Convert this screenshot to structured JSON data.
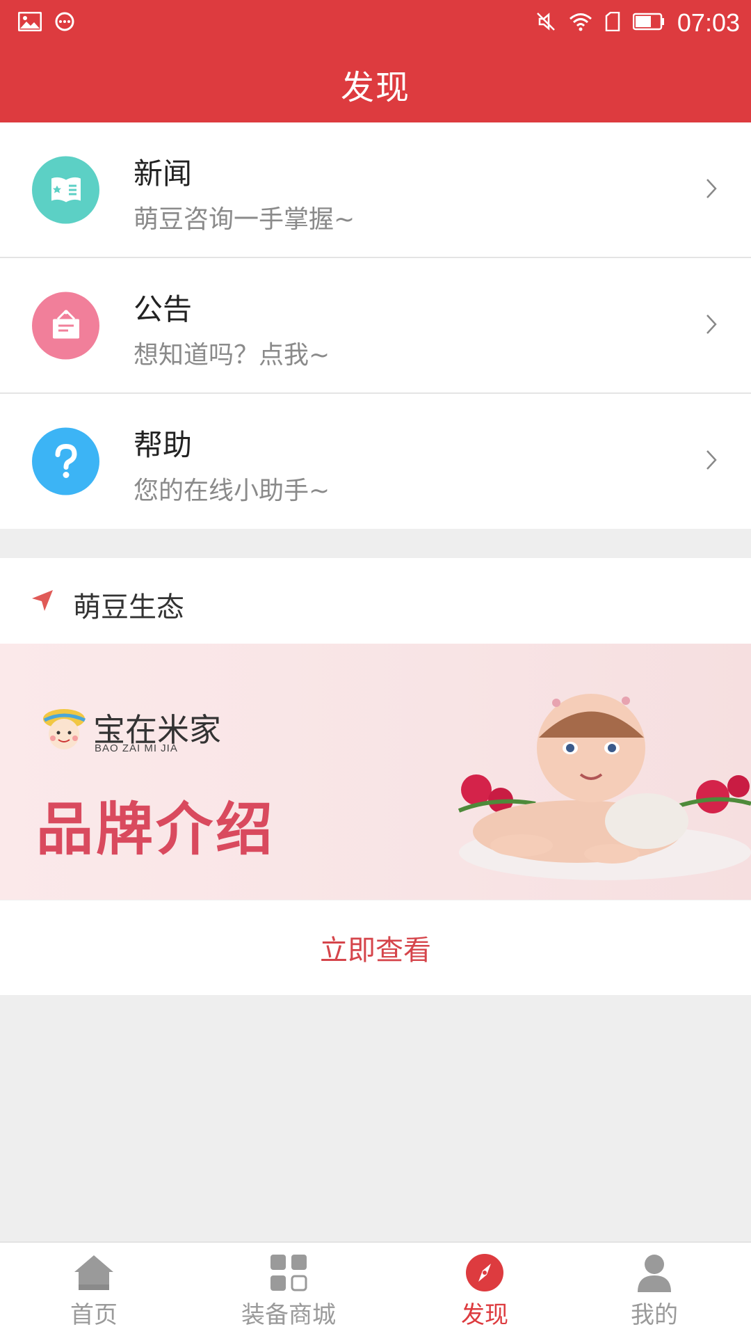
{
  "status_bar": {
    "time": "07:03",
    "left_icons": [
      "image-icon",
      "chat-bubble-icon"
    ],
    "right_icons": [
      "mute-icon",
      "wifi-icon",
      "sim-icon",
      "battery-icon"
    ]
  },
  "header": {
    "title": "发现"
  },
  "menu": {
    "items": [
      {
        "title": "新闻",
        "subtitle": "萌豆咨询一手掌握~",
        "icon": "news-icon",
        "color": "#5cd0c5"
      },
      {
        "title": "公告",
        "subtitle": "想知道吗？点我~",
        "icon": "notice-board-icon",
        "color": "#f17f9a"
      },
      {
        "title": "帮助",
        "subtitle": "您的在线小助手~",
        "icon": "question-icon",
        "color": "#3cb4f5"
      }
    ]
  },
  "ecosystem": {
    "title": "萌豆生态",
    "banner": {
      "brand_cn": "宝在米家",
      "brand_en": "BAO ZAI MI JIA",
      "headline": "品牌介绍"
    },
    "view_button": "立即查看"
  },
  "tabbar": {
    "tabs": [
      {
        "label": "首页",
        "icon": "home-icon",
        "active": false
      },
      {
        "label": "装备商城",
        "icon": "grid-icon",
        "active": false
      },
      {
        "label": "发现",
        "icon": "compass-icon",
        "active": true
      },
      {
        "label": "我的",
        "icon": "user-icon",
        "active": false
      }
    ]
  },
  "colors": {
    "primary": "#dd3b3f",
    "tab_inactive": "#9a9a9a",
    "background": "#eeeeee"
  }
}
